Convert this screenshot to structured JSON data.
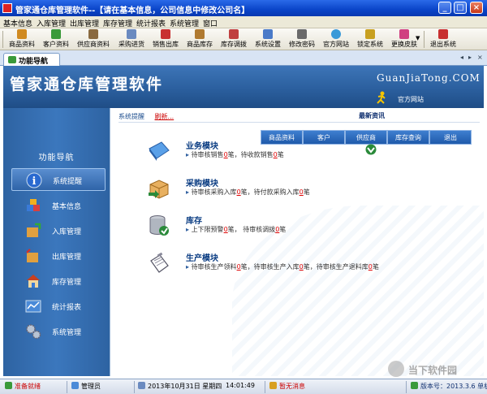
{
  "window": {
    "title": "管家通仓库管理软件--【请在基本信息，公司信息中修改公司名】"
  },
  "menu": [
    "基本信息",
    "入库管理",
    "出库管理",
    "库存管理",
    "统计报表",
    "系统管理",
    "窗口"
  ],
  "toolbar": [
    {
      "label": "商品资料",
      "color": "#d08a20"
    },
    {
      "label": "客户资料",
      "color": "#3a9a3a"
    },
    {
      "label": "供应商资料",
      "color": "#8a6a40"
    },
    {
      "label": "采购进货",
      "color": "#6a8ac0"
    },
    {
      "label": "销售出库",
      "color": "#c83030"
    },
    {
      "label": "商品库存",
      "color": "#b07a30"
    },
    {
      "label": "库存调拨",
      "color": "#c04040"
    },
    {
      "label": "系统设置",
      "color": "#4a7ac8"
    },
    {
      "label": "修改密码",
      "color": "#6a6a6a"
    },
    {
      "label": "官方网站",
      "color": "#3a9ad8"
    },
    {
      "label": "锁定系统",
      "color": "#c8a020"
    },
    {
      "label": "更换皮肤",
      "color": "#d04080"
    },
    {
      "label": "退出系统",
      "color": "#c83030"
    }
  ],
  "tab": {
    "label": "功能导航"
  },
  "banner": {
    "brand": "管家通仓库管理软件",
    "domain": "GuanJiaTong.COM",
    "site_link": "官方网站"
  },
  "nav": {
    "title": "功能导航",
    "items": [
      {
        "label": "系统提醒",
        "active": true
      },
      {
        "label": "基本信息",
        "active": false
      },
      {
        "label": "入库管理",
        "active": false
      },
      {
        "label": "出库管理",
        "active": false
      },
      {
        "label": "库存管理",
        "active": false
      },
      {
        "label": "统计报表",
        "active": false
      },
      {
        "label": "系统管理",
        "active": false
      }
    ]
  },
  "content": {
    "tab_reminder": "系统提醒",
    "refresh": "刷新...",
    "news": "最新资讯",
    "quick_buttons": [
      "商品资料",
      "客户",
      "供应商",
      "库存查询",
      "退出"
    ],
    "modules": [
      {
        "title": "业务模块",
        "segments": [
          "待审核销售",
          "0",
          "笔，待收款销售",
          "0",
          "笔"
        ]
      },
      {
        "title": "采购模块",
        "segments": [
          "待审核采购入库",
          "0",
          "笔，待付款采购入库",
          "0",
          "笔"
        ]
      },
      {
        "title": "库存",
        "segments": [
          "上下限预警",
          "0",
          "笔， 待审核调拨",
          "0",
          "笔"
        ]
      },
      {
        "title": "生产模块",
        "segments": [
          "待审核生产领料",
          "0",
          "笔，待审核生产入库",
          "0",
          "笔，待审核生产退料库",
          "0",
          "笔"
        ]
      }
    ]
  },
  "status": {
    "ready": "准备就绪",
    "user": "管理员",
    "date": "2013年10月31日 星期四",
    "time": "14:01:49",
    "message": "暂无消息",
    "version": "版本号：2013.3.6 单机"
  },
  "watermark": "当下软件园"
}
